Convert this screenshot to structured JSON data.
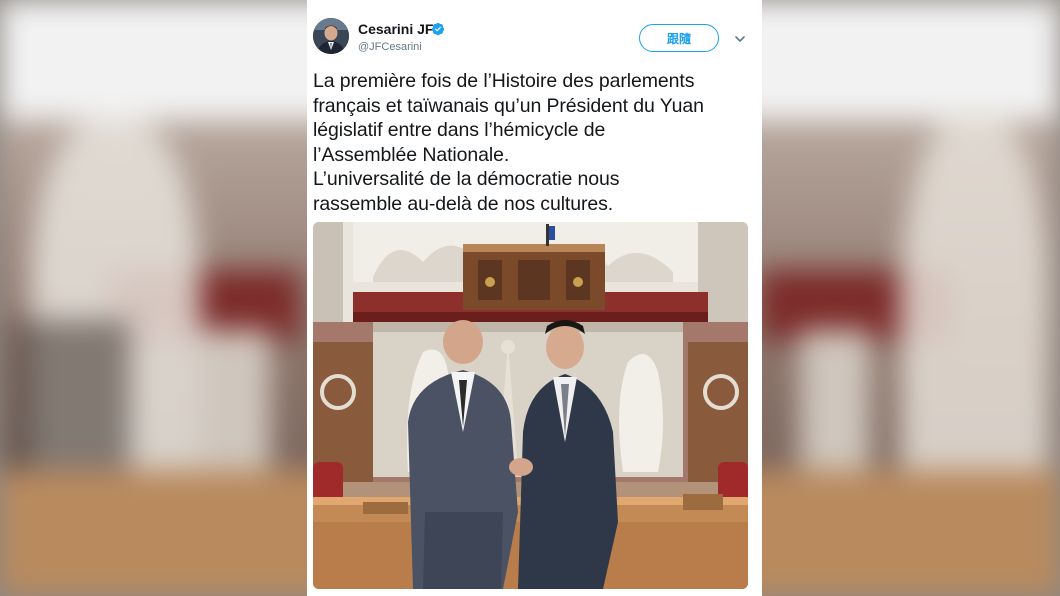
{
  "author": {
    "display_name": "Cesarini JF",
    "handle": "@JFCesarini",
    "verified": true,
    "avatar_icon": "profile-avatar"
  },
  "actions": {
    "follow_label": "跟隨",
    "more_icon": "chevron-down-icon"
  },
  "tweet": {
    "lines": [
      "La première fois de l’Histoire des parlements",
      "français et taïwanais qu’un Président du Yuan",
      "législatif entre dans l’hémicycle de",
      "l’Assemblée Nationale.",
      "L’universalité de la démocratie nous",
      "rassemble au-delà de nos cultures."
    ]
  },
  "media": {
    "type": "photo"
  },
  "colors": {
    "accent": "#1da1f2",
    "text": "#14171a",
    "secondary": "#657786"
  }
}
